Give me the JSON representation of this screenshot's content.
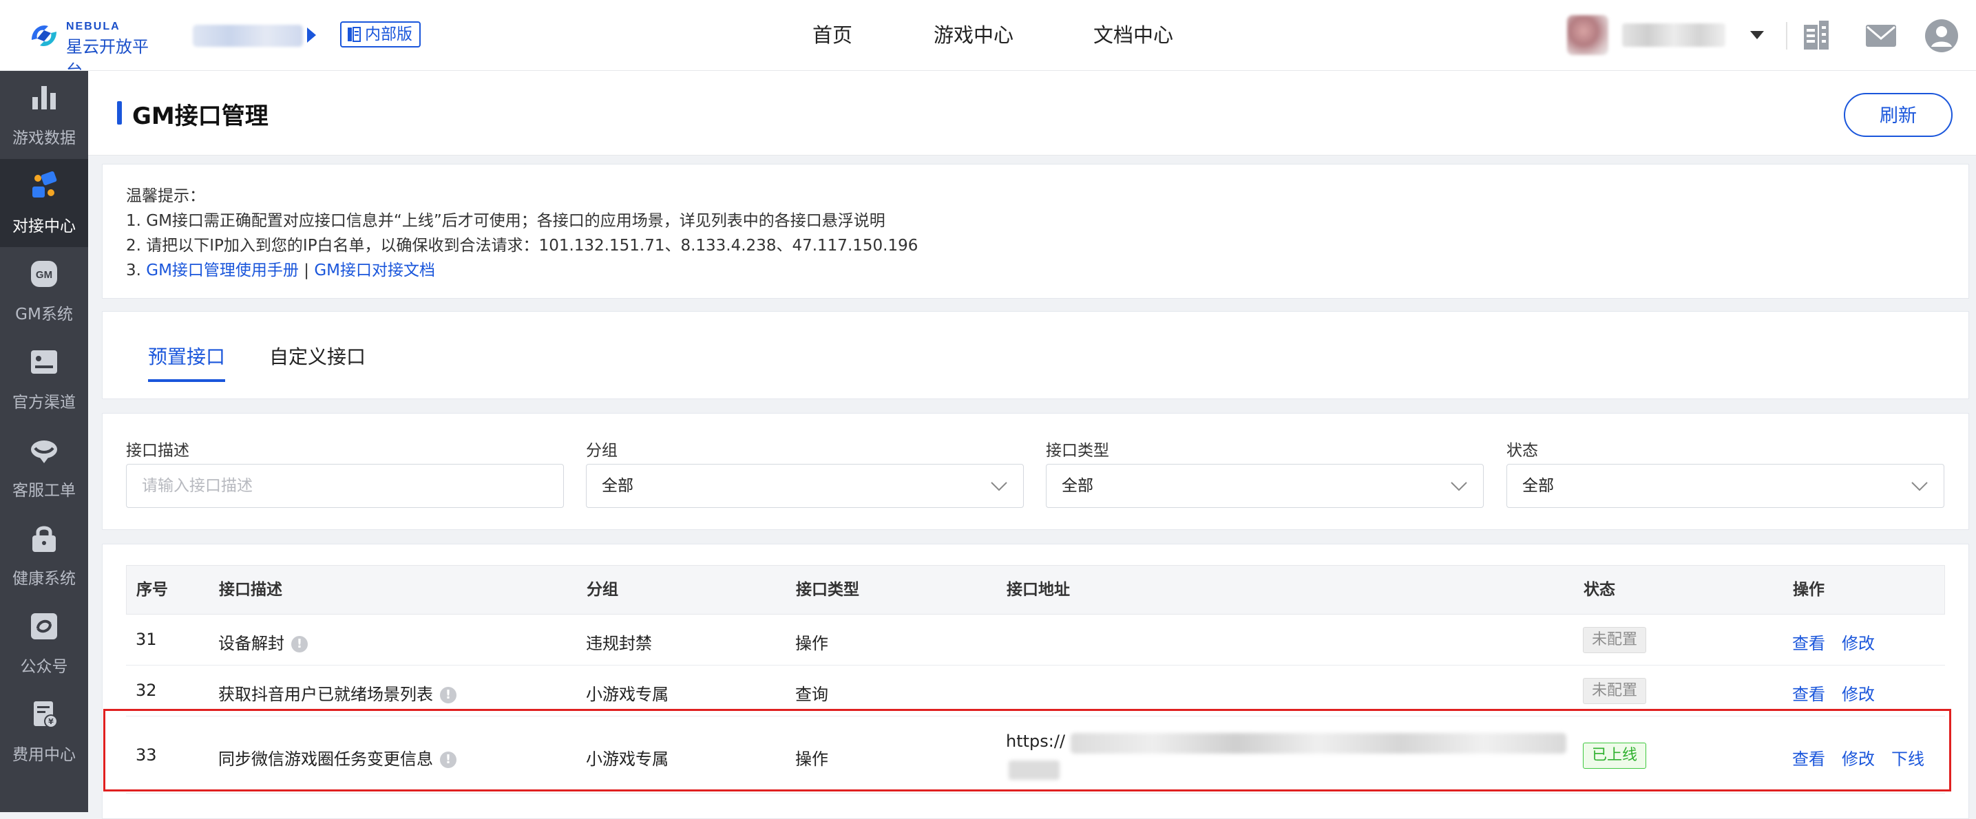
{
  "brand": {
    "logo_en": "NEBULA",
    "logo_cn": "星云开放平台",
    "edition_badge": "内部版"
  },
  "topnav": {
    "items": [
      "首页",
      "游戏中心",
      "文档中心"
    ]
  },
  "colors": {
    "primary": "#1a56db",
    "sidebar_bg": "#3c3f47",
    "sidebar_active": "#2b2e35",
    "online": "#2fb12f",
    "highlight_border": "#e02020"
  },
  "sidebar": {
    "items": [
      {
        "label": "游戏数据",
        "icon": "bar-chart-icon"
      },
      {
        "label": "对接中心",
        "icon": "integration-icon",
        "active": true
      },
      {
        "label": "GM系统",
        "icon": "gm-icon"
      },
      {
        "label": "官方渠道",
        "icon": "id-card-icon"
      },
      {
        "label": "客服工单",
        "icon": "headset-icon"
      },
      {
        "label": "健康系统",
        "icon": "lock-icon"
      },
      {
        "label": "公众号",
        "icon": "refresh-circle-icon"
      },
      {
        "label": "费用中心",
        "icon": "bill-icon"
      }
    ]
  },
  "page": {
    "title": "GM接口管理",
    "refresh_label": "刷新"
  },
  "tips": {
    "heading": "温馨提示：",
    "line1": "1. GM接口需正确配置对应接口信息并“上线”后才可使用；各接口的应用场景，详见列表中的各接口悬浮说明",
    "line2": "2. 请把以下IP加入到您的IP白名单，以确保收到合法请求：101.132.151.71、8.133.4.238、47.117.150.196",
    "line3_prefix": "3. ",
    "link_manual": "GM接口管理使用手册",
    "separator": " | ",
    "link_doc": "GM接口对接文档"
  },
  "tabs": [
    {
      "label": "预置接口",
      "active": true
    },
    {
      "label": "自定义接口",
      "active": false
    }
  ],
  "filters": {
    "desc": {
      "label": "接口描述",
      "placeholder": "请输入接口描述"
    },
    "group": {
      "label": "分组",
      "value": "全部"
    },
    "type": {
      "label": "接口类型",
      "value": "全部"
    },
    "status": {
      "label": "状态",
      "value": "全部"
    }
  },
  "table": {
    "headers": [
      "序号",
      "接口描述",
      "分组",
      "接口类型",
      "接口地址",
      "状态",
      "操作"
    ],
    "rows": [
      {
        "id": "31",
        "desc": "设备解封",
        "group": "违规封禁",
        "type": "操作",
        "url": "",
        "status": "未配置",
        "actions": [
          "查看",
          "修改"
        ]
      },
      {
        "id": "32",
        "desc": "获取抖音用户已就绪场景列表",
        "group": "小游戏专属",
        "type": "查询",
        "url": "",
        "status": "未配置",
        "actions": [
          "查看",
          "修改"
        ]
      },
      {
        "id": "33",
        "desc": "同步微信游戏圈任务变更信息",
        "group": "小游戏专属",
        "type": "操作",
        "url": "https://",
        "status": "已上线",
        "actions": [
          "查看",
          "修改",
          "下线"
        ]
      }
    ]
  }
}
